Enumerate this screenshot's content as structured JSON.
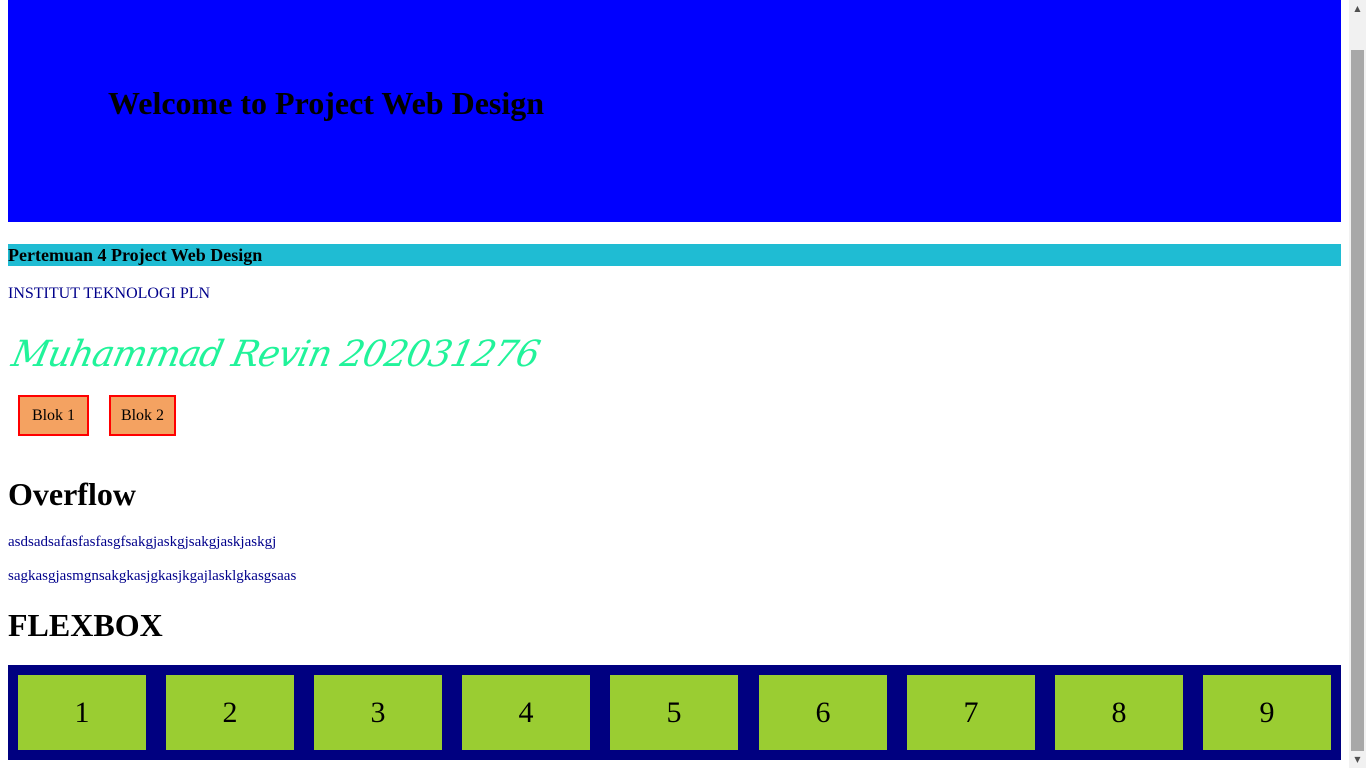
{
  "banner": {
    "title": "Welcome to Project Web Design",
    "background": "#0000ff"
  },
  "subtitle": {
    "text": "Pertemuan 4 Project Web Design",
    "background": "#1fbcd3"
  },
  "institute": "INSTITUT TEKNOLOGI PLN",
  "author": {
    "text": "Muhammad Revin 202031276",
    "color": "#21f39a"
  },
  "blocks": [
    {
      "label": "Blok 1"
    },
    {
      "label": "Blok 2"
    }
  ],
  "block_style": {
    "background": "#f4a261",
    "border": "#ff0000"
  },
  "overflow": {
    "heading": "Overflow",
    "lines": [
      "asdsadsafasfasfasgfsakgjaskgjsakgjaskjaskgj",
      "sagkasgjasmgnsakgkasjgkasjkgajlasklgkasgsaas"
    ]
  },
  "flexbox": {
    "heading": "FLEXBOX",
    "items": [
      "1",
      "2",
      "3",
      "4",
      "5",
      "6",
      "7",
      "8",
      "9"
    ],
    "container_color": "#000080",
    "item_color": "#9acd32"
  },
  "scrollbar": {
    "up_icon": "triangle-up-icon",
    "down_icon": "triangle-down-icon"
  }
}
